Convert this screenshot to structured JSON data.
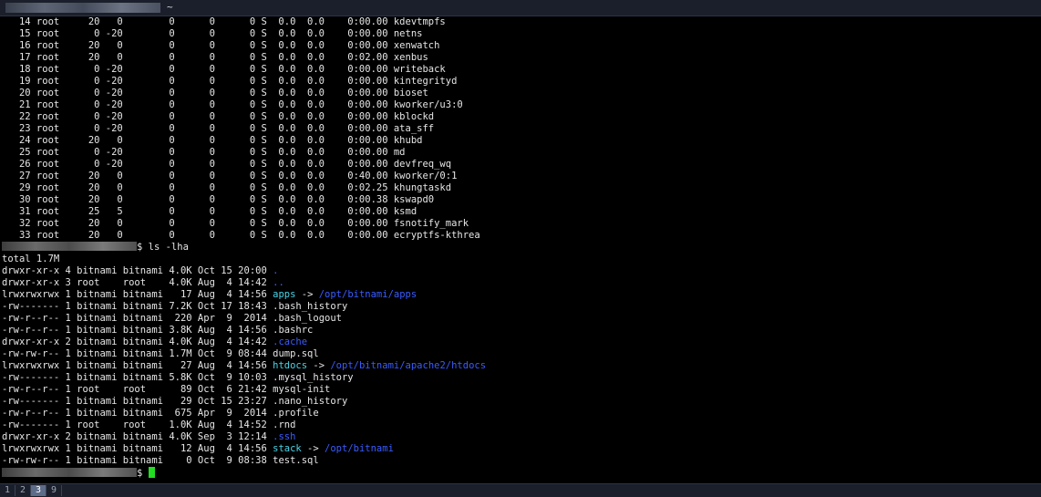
{
  "window": {
    "title": "~"
  },
  "top_rows": [
    {
      "pid": "14",
      "user": "root",
      "pr": "20",
      "ni": "0",
      "virt": "0",
      "res": "0",
      "shr": "0",
      "s": "S",
      "cpu": "0.0",
      "mem": "0.0",
      "time": "0:00.00",
      "cmd": "kdevtmpfs"
    },
    {
      "pid": "15",
      "user": "root",
      "pr": "0",
      "ni": "-20",
      "virt": "0",
      "res": "0",
      "shr": "0",
      "s": "S",
      "cpu": "0.0",
      "mem": "0.0",
      "time": "0:00.00",
      "cmd": "netns"
    },
    {
      "pid": "16",
      "user": "root",
      "pr": "20",
      "ni": "0",
      "virt": "0",
      "res": "0",
      "shr": "0",
      "s": "S",
      "cpu": "0.0",
      "mem": "0.0",
      "time": "0:00.00",
      "cmd": "xenwatch"
    },
    {
      "pid": "17",
      "user": "root",
      "pr": "20",
      "ni": "0",
      "virt": "0",
      "res": "0",
      "shr": "0",
      "s": "S",
      "cpu": "0.0",
      "mem": "0.0",
      "time": "0:02.00",
      "cmd": "xenbus"
    },
    {
      "pid": "18",
      "user": "root",
      "pr": "0",
      "ni": "-20",
      "virt": "0",
      "res": "0",
      "shr": "0",
      "s": "S",
      "cpu": "0.0",
      "mem": "0.0",
      "time": "0:00.00",
      "cmd": "writeback"
    },
    {
      "pid": "19",
      "user": "root",
      "pr": "0",
      "ni": "-20",
      "virt": "0",
      "res": "0",
      "shr": "0",
      "s": "S",
      "cpu": "0.0",
      "mem": "0.0",
      "time": "0:00.00",
      "cmd": "kintegrityd"
    },
    {
      "pid": "20",
      "user": "root",
      "pr": "0",
      "ni": "-20",
      "virt": "0",
      "res": "0",
      "shr": "0",
      "s": "S",
      "cpu": "0.0",
      "mem": "0.0",
      "time": "0:00.00",
      "cmd": "bioset"
    },
    {
      "pid": "21",
      "user": "root",
      "pr": "0",
      "ni": "-20",
      "virt": "0",
      "res": "0",
      "shr": "0",
      "s": "S",
      "cpu": "0.0",
      "mem": "0.0",
      "time": "0:00.00",
      "cmd": "kworker/u3:0"
    },
    {
      "pid": "22",
      "user": "root",
      "pr": "0",
      "ni": "-20",
      "virt": "0",
      "res": "0",
      "shr": "0",
      "s": "S",
      "cpu": "0.0",
      "mem": "0.0",
      "time": "0:00.00",
      "cmd": "kblockd"
    },
    {
      "pid": "23",
      "user": "root",
      "pr": "0",
      "ni": "-20",
      "virt": "0",
      "res": "0",
      "shr": "0",
      "s": "S",
      "cpu": "0.0",
      "mem": "0.0",
      "time": "0:00.00",
      "cmd": "ata_sff"
    },
    {
      "pid": "24",
      "user": "root",
      "pr": "20",
      "ni": "0",
      "virt": "0",
      "res": "0",
      "shr": "0",
      "s": "S",
      "cpu": "0.0",
      "mem": "0.0",
      "time": "0:00.00",
      "cmd": "khubd"
    },
    {
      "pid": "25",
      "user": "root",
      "pr": "0",
      "ni": "-20",
      "virt": "0",
      "res": "0",
      "shr": "0",
      "s": "S",
      "cpu": "0.0",
      "mem": "0.0",
      "time": "0:00.00",
      "cmd": "md"
    },
    {
      "pid": "26",
      "user": "root",
      "pr": "0",
      "ni": "-20",
      "virt": "0",
      "res": "0",
      "shr": "0",
      "s": "S",
      "cpu": "0.0",
      "mem": "0.0",
      "time": "0:00.00",
      "cmd": "devfreq_wq"
    },
    {
      "pid": "27",
      "user": "root",
      "pr": "20",
      "ni": "0",
      "virt": "0",
      "res": "0",
      "shr": "0",
      "s": "S",
      "cpu": "0.0",
      "mem": "0.0",
      "time": "0:40.00",
      "cmd": "kworker/0:1"
    },
    {
      "pid": "29",
      "user": "root",
      "pr": "20",
      "ni": "0",
      "virt": "0",
      "res": "0",
      "shr": "0",
      "s": "S",
      "cpu": "0.0",
      "mem": "0.0",
      "time": "0:02.25",
      "cmd": "khungtaskd"
    },
    {
      "pid": "30",
      "user": "root",
      "pr": "20",
      "ni": "0",
      "virt": "0",
      "res": "0",
      "shr": "0",
      "s": "S",
      "cpu": "0.0",
      "mem": "0.0",
      "time": "0:00.38",
      "cmd": "kswapd0"
    },
    {
      "pid": "31",
      "user": "root",
      "pr": "25",
      "ni": "5",
      "virt": "0",
      "res": "0",
      "shr": "0",
      "s": "S",
      "cpu": "0.0",
      "mem": "0.0",
      "time": "0:00.00",
      "cmd": "ksmd"
    },
    {
      "pid": "32",
      "user": "root",
      "pr": "20",
      "ni": "0",
      "virt": "0",
      "res": "0",
      "shr": "0",
      "s": "S",
      "cpu": "0.0",
      "mem": "0.0",
      "time": "0:00.00",
      "cmd": "fsnotify_mark"
    },
    {
      "pid": "33",
      "user": "root",
      "pr": "20",
      "ni": "0",
      "virt": "0",
      "res": "0",
      "shr": "0",
      "s": "S",
      "cpu": "0.0",
      "mem": "0.0",
      "time": "0:00.00",
      "cmd": "ecryptfs-kthrea"
    }
  ],
  "prompt": {
    "suffix": "$ ls -lha",
    "final_suffix": "$ "
  },
  "ls_total": "total 1.7M",
  "ls_rows": [
    {
      "perm": "drwxr-xr-x",
      "links": "4",
      "owner": "bitnami",
      "group": "bitnami",
      "size": "4.0K",
      "mon": "Oct",
      "day": "15",
      "time": "20:00",
      "name": ".",
      "kind": "dir",
      "target": ""
    },
    {
      "perm": "drwxr-xr-x",
      "links": "3",
      "owner": "root",
      "group": "root",
      "size": "4.0K",
      "mon": "Aug",
      "day": "4",
      "time": "14:42",
      "name": "..",
      "kind": "dir",
      "target": ""
    },
    {
      "perm": "lrwxrwxrwx",
      "links": "1",
      "owner": "bitnami",
      "group": "bitnami",
      "size": "17",
      "mon": "Aug",
      "day": "4",
      "time": "14:56",
      "name": "apps",
      "kind": "link",
      "target": "/opt/bitnami/apps"
    },
    {
      "perm": "-rw-------",
      "links": "1",
      "owner": "bitnami",
      "group": "bitnami",
      "size": "7.2K",
      "mon": "Oct",
      "day": "17",
      "time": "18:43",
      "name": ".bash_history",
      "kind": "file",
      "target": ""
    },
    {
      "perm": "-rw-r--r--",
      "links": "1",
      "owner": "bitnami",
      "group": "bitnami",
      "size": "220",
      "mon": "Apr",
      "day": "9",
      "time": "2014",
      "name": ".bash_logout",
      "kind": "file",
      "target": ""
    },
    {
      "perm": "-rw-r--r--",
      "links": "1",
      "owner": "bitnami",
      "group": "bitnami",
      "size": "3.8K",
      "mon": "Aug",
      "day": "4",
      "time": "14:56",
      "name": ".bashrc",
      "kind": "file",
      "target": ""
    },
    {
      "perm": "drwxr-xr-x",
      "links": "2",
      "owner": "bitnami",
      "group": "bitnami",
      "size": "4.0K",
      "mon": "Aug",
      "day": "4",
      "time": "14:42",
      "name": ".cache",
      "kind": "dir",
      "target": ""
    },
    {
      "perm": "-rw-rw-r--",
      "links": "1",
      "owner": "bitnami",
      "group": "bitnami",
      "size": "1.7M",
      "mon": "Oct",
      "day": "9",
      "time": "08:44",
      "name": "dump.sql",
      "kind": "file",
      "target": ""
    },
    {
      "perm": "lrwxrwxrwx",
      "links": "1",
      "owner": "bitnami",
      "group": "bitnami",
      "size": "27",
      "mon": "Aug",
      "day": "4",
      "time": "14:56",
      "name": "htdocs",
      "kind": "link",
      "target": "/opt/bitnami/apache2/htdocs"
    },
    {
      "perm": "-rw-------",
      "links": "1",
      "owner": "bitnami",
      "group": "bitnami",
      "size": "5.8K",
      "mon": "Oct",
      "day": "9",
      "time": "10:03",
      "name": ".mysql_history",
      "kind": "file",
      "target": ""
    },
    {
      "perm": "-rw-r--r--",
      "links": "1",
      "owner": "root",
      "group": "root",
      "size": "89",
      "mon": "Oct",
      "day": "6",
      "time": "21:42",
      "name": "mysql-init",
      "kind": "file",
      "target": ""
    },
    {
      "perm": "-rw-------",
      "links": "1",
      "owner": "bitnami",
      "group": "bitnami",
      "size": "29",
      "mon": "Oct",
      "day": "15",
      "time": "23:27",
      "name": ".nano_history",
      "kind": "file",
      "target": ""
    },
    {
      "perm": "-rw-r--r--",
      "links": "1",
      "owner": "bitnami",
      "group": "bitnami",
      "size": "675",
      "mon": "Apr",
      "day": "9",
      "time": "2014",
      "name": ".profile",
      "kind": "file",
      "target": ""
    },
    {
      "perm": "-rw-------",
      "links": "1",
      "owner": "root",
      "group": "root",
      "size": "1.0K",
      "mon": "Aug",
      "day": "4",
      "time": "14:52",
      "name": ".rnd",
      "kind": "file",
      "target": ""
    },
    {
      "perm": "drwxr-xr-x",
      "links": "2",
      "owner": "bitnami",
      "group": "bitnami",
      "size": "4.0K",
      "mon": "Sep",
      "day": "3",
      "time": "12:14",
      "name": ".ssh",
      "kind": "dir",
      "target": ""
    },
    {
      "perm": "lrwxrwxrwx",
      "links": "1",
      "owner": "bitnami",
      "group": "bitnami",
      "size": "12",
      "mon": "Aug",
      "day": "4",
      "time": "14:56",
      "name": "stack",
      "kind": "link",
      "target": "/opt/bitnami"
    },
    {
      "perm": "-rw-rw-r--",
      "links": "1",
      "owner": "bitnami",
      "group": "bitnami",
      "size": "0",
      "mon": "Oct",
      "day": "9",
      "time": "08:38",
      "name": "test.sql",
      "kind": "file",
      "target": ""
    }
  ],
  "tabs": [
    {
      "label": "1",
      "active": false
    },
    {
      "label": "2",
      "active": false
    },
    {
      "label": "3",
      "active": true
    },
    {
      "label": "9",
      "active": false
    }
  ],
  "colors": {
    "background": "#000000",
    "foreground": "#e6e6e6",
    "directory": "#3a5cff",
    "symlink": "#4ad4e6",
    "cursor": "#22dd22",
    "active_tab": "#5d6c88"
  }
}
